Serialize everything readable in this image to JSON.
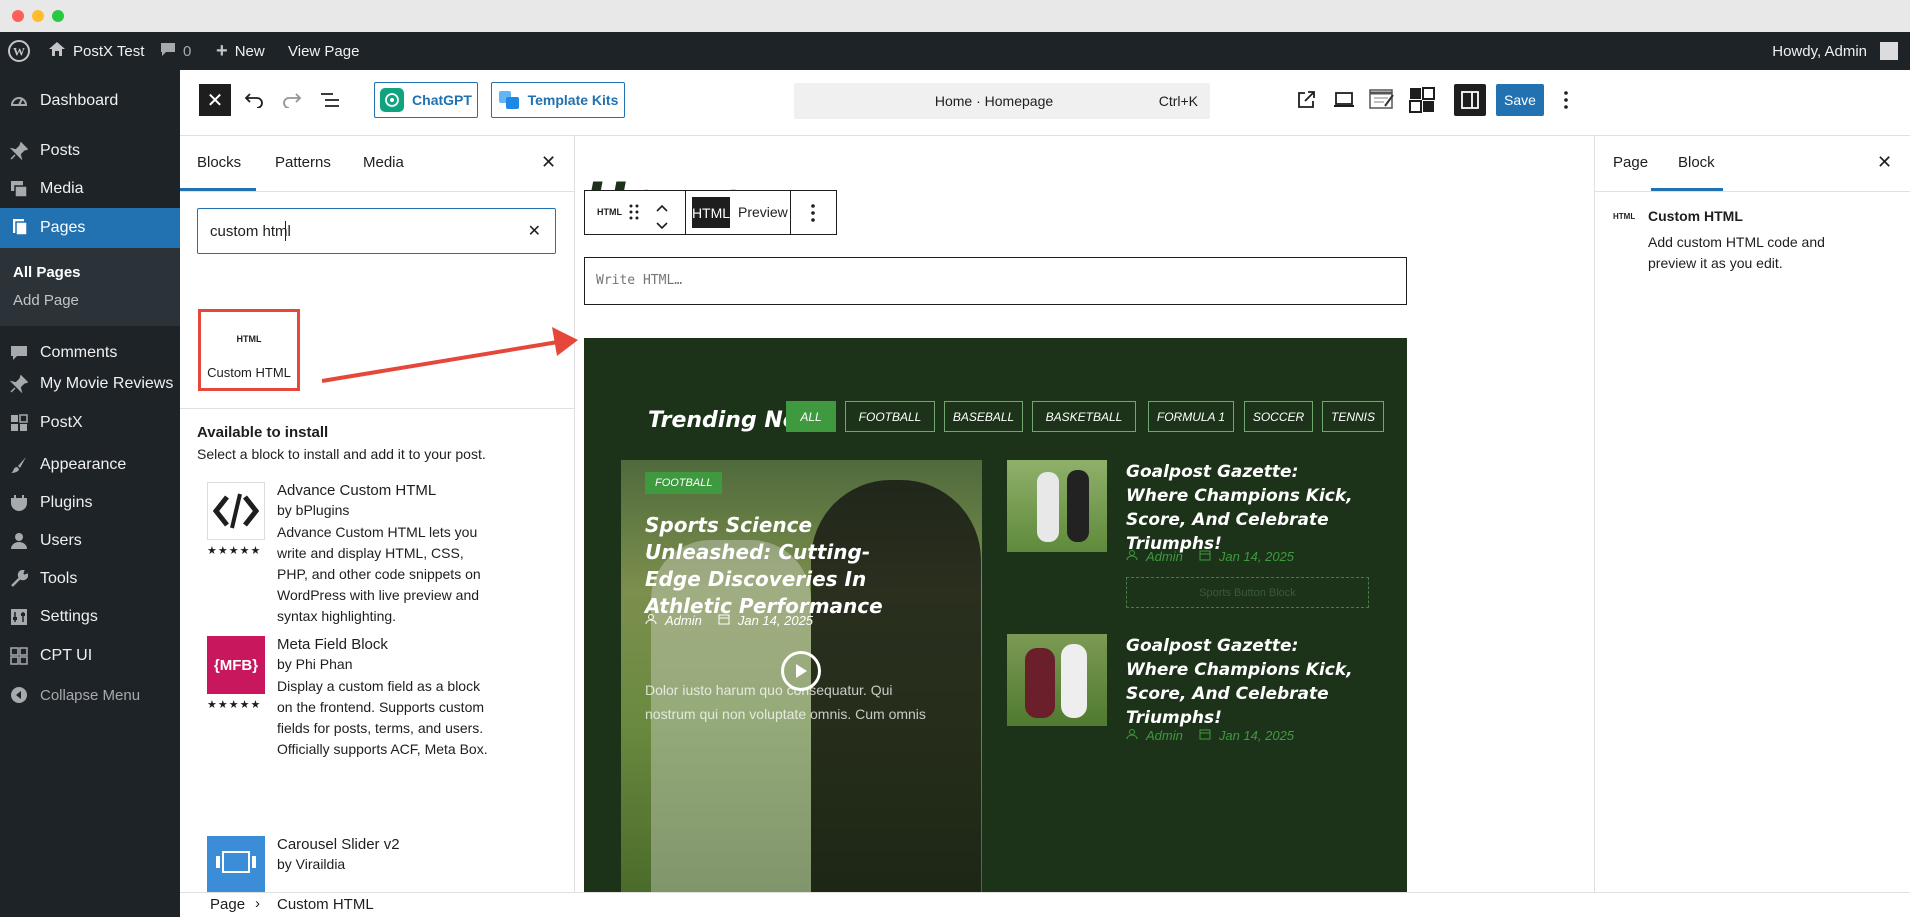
{
  "admin_bar": {
    "site_name": "PostX Test",
    "comments_count": "0",
    "new_label": "New",
    "view_page_label": "View Page",
    "howdy": "Howdy, Admin"
  },
  "sidebar": {
    "items": [
      {
        "label": "Dashboard",
        "icon": "dashboard-icon"
      },
      {
        "label": "Posts",
        "icon": "pin-icon"
      },
      {
        "label": "Media",
        "icon": "media-icon"
      },
      {
        "label": "Pages",
        "icon": "pages-icon"
      },
      {
        "label": "Comments",
        "icon": "comment-icon"
      },
      {
        "label": "My Movie Reviews",
        "icon": "pin-icon"
      },
      {
        "label": "PostX",
        "icon": "postx-icon"
      },
      {
        "label": "Appearance",
        "icon": "brush-icon"
      },
      {
        "label": "Plugins",
        "icon": "plugin-icon"
      },
      {
        "label": "Users",
        "icon": "user-icon"
      },
      {
        "label": "Tools",
        "icon": "wrench-icon"
      },
      {
        "label": "Settings",
        "icon": "settings-icon"
      },
      {
        "label": "CPT UI",
        "icon": "grid-icon"
      },
      {
        "label": "Collapse Menu",
        "icon": "collapse-icon"
      }
    ],
    "pages_sub": [
      "All Pages",
      "Add Page"
    ]
  },
  "toolbar": {
    "chatgpt_label": "ChatGPT",
    "template_kits_label": "Template Kits",
    "doc_title": "Home · Homepage",
    "shortcut": "Ctrl+K",
    "save_label": "Save"
  },
  "inserter": {
    "tabs": [
      "Blocks",
      "Patterns",
      "Media"
    ],
    "search_value": "custom html",
    "result_icon_text": "HTML",
    "result_label": "Custom HTML",
    "available_title": "Available to install",
    "available_desc": "Select a block to install and add it to your post.",
    "plugins": [
      {
        "name": "Advance Custom HTML",
        "author": "by bPlugins",
        "desc": "Advance Custom HTML lets you write and display HTML, CSS, PHP, and other code snippets on WordPress with live preview and syntax highlighting.",
        "stars": "★★★★★"
      },
      {
        "name": "Meta Field Block",
        "author": "by Phi Phan",
        "desc": "Display a custom field as a block on the frontend. Supports custom fields for posts, terms, and users. Officially supports ACF, Meta Box.",
        "stars": "★★★★★",
        "logo_text": "{MFB}"
      },
      {
        "name": "Carousel Slider v2",
        "author": "by Viraildia"
      }
    ]
  },
  "canvas": {
    "page_title": "Home",
    "block_toolbar": {
      "icon_text": "HTML",
      "html_tab": "HTML",
      "preview_tab": "Preview"
    },
    "html_placeholder": "Write HTML…",
    "trending": {
      "heading": "Trending Now",
      "filters": [
        "ALL",
        "FOOTBALL",
        "BASEBALL",
        "BASKETBALL",
        "FORMULA 1",
        "SOCCER",
        "TENNIS"
      ],
      "main_post": {
        "category": "FOOTBALL",
        "title": "Sports Science Unleashed: Cutting-Edge Discoveries In Athletic Performance",
        "author": "Admin",
        "date": "Jan 14, 2025",
        "excerpt": "Dolor iusto harum quo consequatur. Qui nostrum qui non voluptate omnis. Cum omnis"
      },
      "side_posts": [
        {
          "title": "Goalpost Gazette: Where Champions Kick, Score, And Celebrate Triumphs!",
          "author": "Admin",
          "date": "Jan 14, 2025",
          "button": "Sports Button Block"
        },
        {
          "title": "Goalpost Gazette: Where Champions Kick, Score, And Celebrate Triumphs!",
          "author": "Admin",
          "date": "Jan 14, 2025"
        }
      ]
    }
  },
  "settings": {
    "tabs": [
      "Page",
      "Block"
    ],
    "block_icon_text": "HTML",
    "block_name": "Custom HTML",
    "block_desc": "Add custom HTML code and preview it as you edit."
  },
  "breadcrumb": {
    "items": [
      "Page",
      "Custom HTML"
    ],
    "separator": "›"
  },
  "colors": {
    "admin_dark": "#1d2327",
    "wp_blue": "#2271b1",
    "trending_bg": "#1c3319",
    "accent_green": "#3f9a3f",
    "arrow_red": "#e5483a"
  }
}
